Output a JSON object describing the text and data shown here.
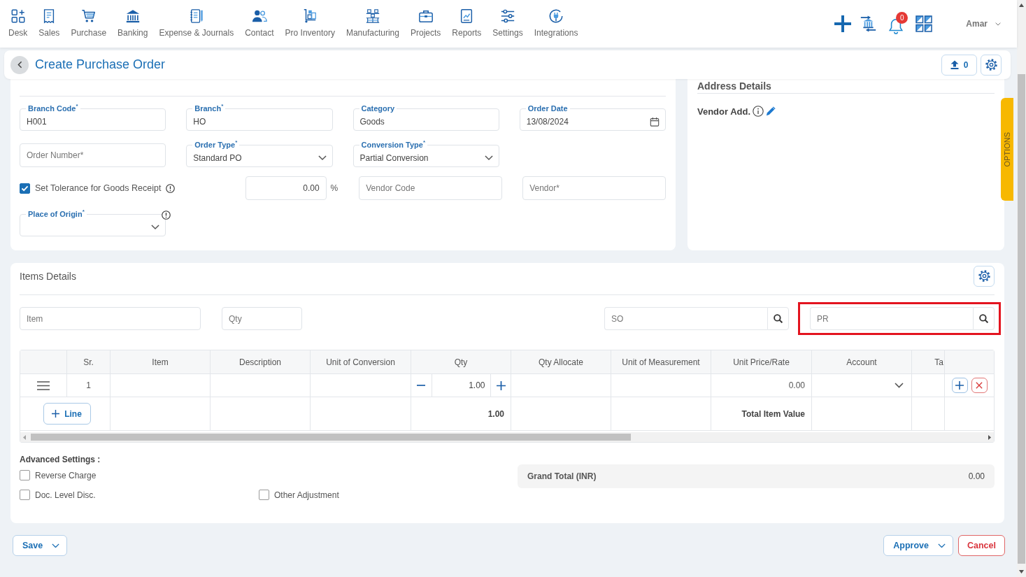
{
  "top_nav": {
    "items": [
      {
        "label": "Desk",
        "selected": false
      },
      {
        "label": "Sales",
        "selected": false
      },
      {
        "label": "Purchase",
        "selected": false
      },
      {
        "label": "Banking",
        "selected": false
      },
      {
        "label": "Expense & Journals",
        "selected": false
      },
      {
        "label": "Contact",
        "selected": false
      },
      {
        "label": "Pro Inventory",
        "selected": false
      },
      {
        "label": "Manufacturing",
        "selected": false
      },
      {
        "label": "Projects",
        "selected": false
      },
      {
        "label": "Reports",
        "selected": false
      },
      {
        "label": "Settings",
        "selected": false
      },
      {
        "label": "Integrations",
        "selected": false
      }
    ],
    "notification_count": "0",
    "user_name": "Amar"
  },
  "page_header": {
    "title": "Create Purchase Order",
    "attachments_count": "0"
  },
  "order_details": {
    "rows": [
      [
        {
          "kind": "text",
          "label": "Branch Code$^{*}$",
          "value": "H001"
        },
        {
          "kind": "text",
          "label": "Branch$^{*}$",
          "value": "HO"
        },
        {
          "kind": "text",
          "label": "Category",
          "value": "Goods"
        },
        {
          "kind": "date",
          "label": "Order Date",
          "value": "13/08/2024"
        }
      ],
      [
        {
          "kind": "input",
          "placeholder": "Order Number*"
        },
        {
          "kind": "select",
          "label": "Order Type$^{*}$",
          "value": "Standard PO"
        },
        {
          "kind": "select",
          "label": "Conversion Type$^{*}$",
          "value": "Partial Conversion"
        }
      ],
      [
        {
          "kind": "checkbox",
          "label": "Set Tolerance for Goods Receipt",
          "checked": true,
          "info": true
        },
        {
          "kind": "percent",
          "value": "0.00",
          "unit": "%"
        },
        {
          "kind": "input",
          "placeholder": "Vendor Code"
        },
        {
          "kind": "input",
          "placeholder": "Vendor*"
        }
      ],
      [
        {
          "kind": "select",
          "label": "Place of Origin$^{*}$",
          "info": true
        }
      ]
    ]
  },
  "address_details": {
    "title": "Address Details",
    "vendor_address_label": "Vendor Add."
  },
  "options_tab": {
    "label": "OPTIONS"
  },
  "items_details": {
    "title": "Items Details",
    "inputs": [
      {
        "placeholder": "Item"
      },
      {
        "placeholder": "Qty"
      }
    ],
    "search_fields": [
      {
        "placeholder": "SO",
        "highlighted": false
      },
      {
        "placeholder": "PR",
        "highlighted": true
      }
    ],
    "table": {
      "columns": [
        "Sr.",
        "Item",
        "Description",
        "Unit of Conversion",
        "Qty",
        "Qty Allocate",
        "Unit of Measurement",
        "Unit Price/Rate",
        "Account",
        "Ta"
      ],
      "rows": [
        {
          "sr": "1",
          "qty": "1.00",
          "unit_price_rate": "0.00"
        }
      ],
      "footer": {
        "add_line_label": "Line",
        "qty_total": "1.00",
        "total_label": "Total Item Value"
      }
    },
    "advanced_settings": {
      "title": "Advanced Settings :",
      "options": [
        {
          "label": "Reverse Charge",
          "checked": false
        },
        {
          "label": "Doc. Level Disc.",
          "checked": false
        },
        {
          "label": "Other Adjustment",
          "checked": false
        }
      ]
    },
    "grand_total": {
      "label": "Grand Total (INR)",
      "value": "0.00"
    }
  },
  "footer": {
    "left": [
      {
        "label": "Save",
        "kind": "dropdown"
      }
    ],
    "right": [
      {
        "label": "Approve",
        "kind": "dropdown"
      },
      {
        "label": "Cancel",
        "kind": "danger"
      }
    ]
  }
}
